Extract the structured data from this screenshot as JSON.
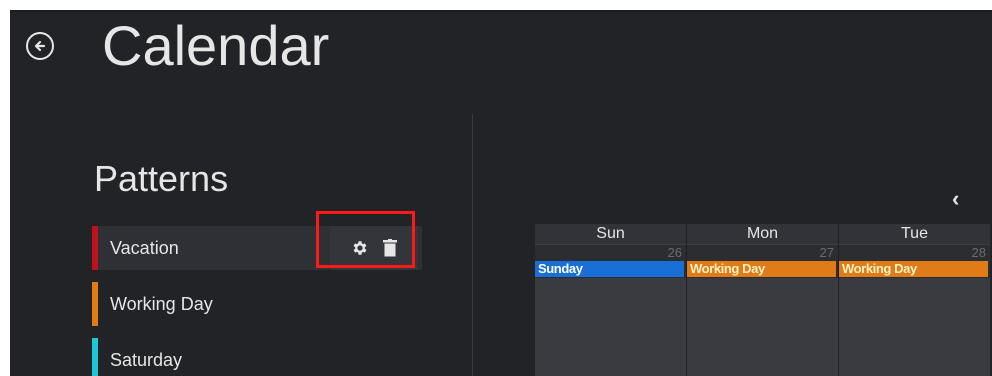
{
  "header": {
    "title": "Calendar",
    "back_icon": "arrow-left-circle-icon"
  },
  "patterns": {
    "heading": "Patterns",
    "items": [
      {
        "label": "Vacation",
        "color": "#c0121c",
        "selected": true
      },
      {
        "label": "Working Day",
        "color": "#e07b17"
      },
      {
        "label": "Saturday",
        "color": "#1ec6d6"
      }
    ],
    "actions": {
      "settings_icon": "gear-icon",
      "delete_icon": "trash-icon"
    }
  },
  "calendar": {
    "nav_prev": "‹",
    "days": [
      {
        "name": "Sun",
        "date": "26",
        "event": "Sunday",
        "event_color": "#1a6fd6",
        "text_color": "#ffffff"
      },
      {
        "name": "Mon",
        "date": "27",
        "event": "Working Day",
        "event_color": "#e07b17",
        "text_color": "#fff1c2"
      },
      {
        "name": "Tue",
        "date": "28",
        "event": "Working Day",
        "event_color": "#e07b17",
        "text_color": "#fff1c2"
      }
    ]
  }
}
